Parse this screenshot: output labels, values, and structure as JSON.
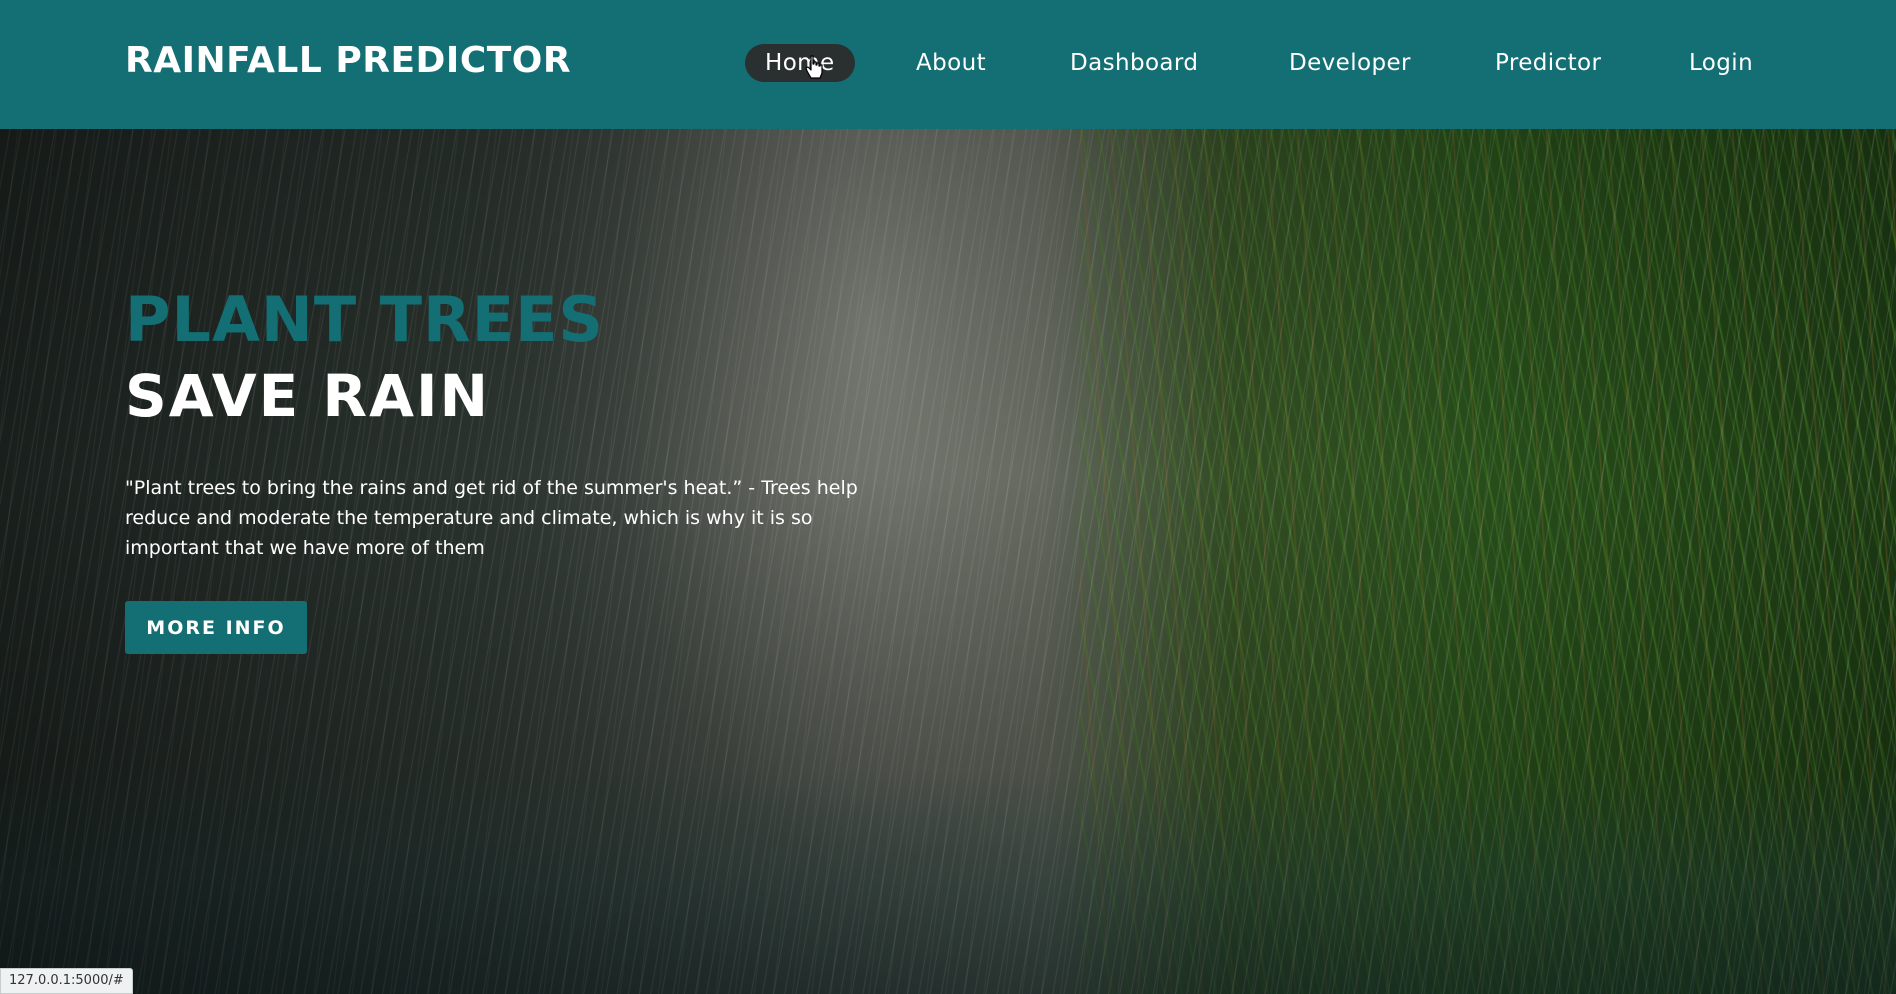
{
  "header": {
    "brand": "RAINFALL PREDICTOR",
    "nav": [
      {
        "label": "Home",
        "active": true
      },
      {
        "label": "About",
        "active": false
      },
      {
        "label": "Dashboard",
        "active": false
      },
      {
        "label": "Developer",
        "active": false
      },
      {
        "label": "Predictor",
        "active": false
      },
      {
        "label": "Login",
        "active": false
      }
    ]
  },
  "hero": {
    "headline_1": "PLANT TREES",
    "headline_2": "SAVE RAIN",
    "quote": "\"Plant trees to bring the rains and get rid of the summer's heat.” - Trees help reduce and moderate the temperature and climate, which is why it is so important that we have more of them",
    "button_label": "MORE INFO",
    "background_image": "rain-over-grass-photo"
  },
  "status_bar": {
    "url": "127.0.0.1:5000/#"
  },
  "colors": {
    "accent": "#136f73",
    "active_nav_bg": "#2a2f30",
    "text": "#ffffff"
  },
  "icons": {
    "cursor": "hand-pointer-icon"
  }
}
